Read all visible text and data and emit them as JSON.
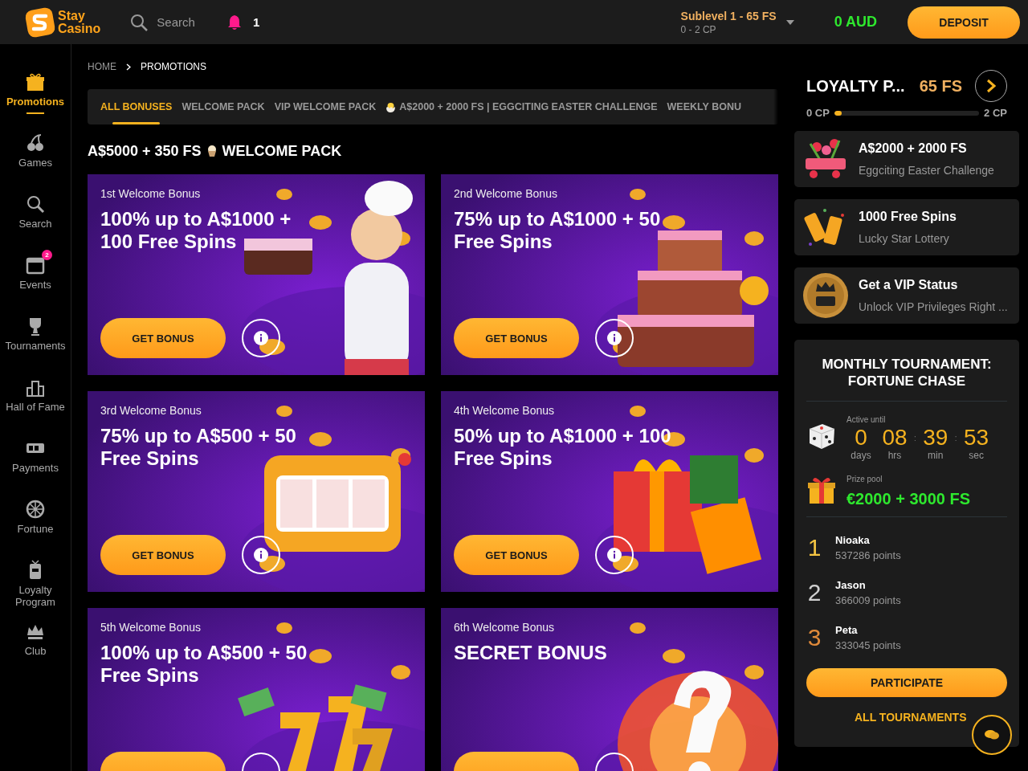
{
  "header": {
    "logo_text": [
      "Stay",
      "Casino"
    ],
    "search": "Search",
    "notifications": "1",
    "level": {
      "title": "Sublevel 1 - 65 FS",
      "range": "0 - 2 CP"
    },
    "balance": "0 AUD",
    "deposit": "DEPOSIT"
  },
  "sidebar": {
    "items": [
      {
        "label": "Promotions",
        "selected": true
      },
      {
        "label": "Games",
        "selected": false
      },
      {
        "label": "Search",
        "selected": false
      },
      {
        "label": "Events",
        "selected": false,
        "badge": "2"
      },
      {
        "label": "Tournaments",
        "selected": false
      },
      {
        "label": "Hall of Fame",
        "selected": false
      },
      {
        "label": "Payments",
        "selected": false
      },
      {
        "label": "Fortune",
        "selected": false
      },
      {
        "label": "Loyalty Program",
        "selected": false
      },
      {
        "label": "Club",
        "selected": false
      }
    ]
  },
  "breadcrumb": [
    "HOME",
    "PROMOTIONS"
  ],
  "tabs": [
    {
      "label": "ALL BONUSES",
      "selected": true
    },
    {
      "label": "WELCOME PACK",
      "selected": false
    },
    {
      "label": "VIP WELCOME PACK",
      "selected": false
    },
    {
      "label": "A$2000 + 2000 FS | EGGCITING EASTER CHALLENGE",
      "selected": false,
      "egg": true
    },
    {
      "label": "WEEKLY BONU",
      "selected": false
    }
  ],
  "section_title": "A$5000 + 350 FS",
  "section_title_suffix": "WELCOME PACK",
  "cards": [
    {
      "kind": "full",
      "subtitle": "1st Welcome Bonus",
      "title": [
        "100% up to A$1000 +",
        "100 Free Spins"
      ],
      "button": "GET BONUS"
    },
    {
      "kind": "full",
      "subtitle": "2nd Welcome Bonus",
      "title": [
        "75% up to A$1000 + 50",
        "Free Spins"
      ],
      "button": "GET BONUS"
    },
    {
      "kind": "full",
      "subtitle": "3rd Welcome Bonus",
      "title": [
        "75% up to A$500 + 50",
        "Free Spins"
      ],
      "button": "GET BONUS"
    },
    {
      "kind": "full",
      "subtitle": "4th Welcome Bonus",
      "title": [
        "50% up to A$1000 + 100",
        "Free Spins"
      ],
      "button": "GET BONUS"
    },
    {
      "kind": "cut",
      "subtitle": "5th Welcome Bonus",
      "title": [
        "100% up to A$500 + 50",
        "Free Spins"
      ]
    },
    {
      "kind": "cut",
      "subtitle": "6th Welcome Bonus",
      "title": [
        "SECRET BONUS"
      ]
    }
  ],
  "loyalty": {
    "title": "LOYALTY P...",
    "reward": "65 FS",
    "from": "0 CP",
    "to": "2 CP",
    "level": 0.05
  },
  "promos": [
    {
      "title": "A$2000 + 2000 FS",
      "subtitle": "Eggciting Easter Challenge"
    },
    {
      "title": "1000 Free Spins",
      "subtitle": "Lucky Star Lottery"
    },
    {
      "title": "Get a VIP Status",
      "subtitle": "Unlock VIP Privileges Right ..."
    }
  ],
  "tournament": {
    "title": [
      "MONTHLY TOURNAMENT:",
      "FORTUNE CHASE"
    ],
    "active_label": "Active until",
    "timer": [
      {
        "value": "0",
        "unit": "days"
      },
      {
        "value": "08",
        "unit": "hrs"
      },
      {
        "value": "39",
        "unit": "min"
      },
      {
        "value": "53",
        "unit": "sec"
      }
    ],
    "separator": ":",
    "prize_label": "Prize pool",
    "prize": "€2000 + 3000 FS",
    "leaders": [
      {
        "rank": "1",
        "name": "Nioaka",
        "points": "537286 points",
        "color": "#f5c542"
      },
      {
        "rank": "2",
        "name": "Jason",
        "points": "366009 points",
        "color": "#d0d0d0"
      },
      {
        "rank": "3",
        "name": "Peta",
        "points": "333045 points",
        "color": "#e08a3a"
      }
    ],
    "participate": "PARTICIPATE",
    "all": "ALL TOURNAMENTS"
  }
}
